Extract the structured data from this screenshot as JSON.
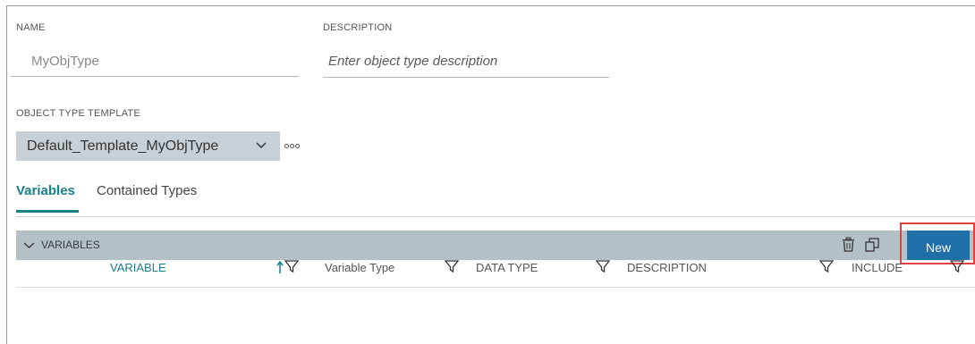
{
  "form": {
    "name_label": "NAME",
    "name_value": "MyObjType",
    "description_label": "DESCRIPTION",
    "description_placeholder": "Enter object type description",
    "template_label": "OBJECT TYPE TEMPLATE",
    "template_value": "Default_Template_MyObjType",
    "more_icon": "more-dots-icon"
  },
  "tabs": [
    {
      "label": "Variables",
      "active": true
    },
    {
      "label": "Contained Types",
      "active": false
    }
  ],
  "section": {
    "title": "VARIABLES",
    "expanded_icon": "chevron-down-icon",
    "delete_icon": "trash-icon",
    "copy_icon": "copy-icon",
    "new_label": "New",
    "highlight_color": "#e04242"
  },
  "table": {
    "columns": [
      {
        "label": "VARIABLE",
        "sort": "ascending"
      },
      {
        "label": "Variable Type"
      },
      {
        "label": "DATA TYPE"
      },
      {
        "label": "DESCRIPTION"
      },
      {
        "label": "INCLUDE"
      }
    ],
    "rows": []
  },
  "colors": {
    "accent": "#1a7f86",
    "button": "#1f6fa8",
    "section_bar": "#b3c1c6",
    "select_bg": "#c7d0d6"
  }
}
